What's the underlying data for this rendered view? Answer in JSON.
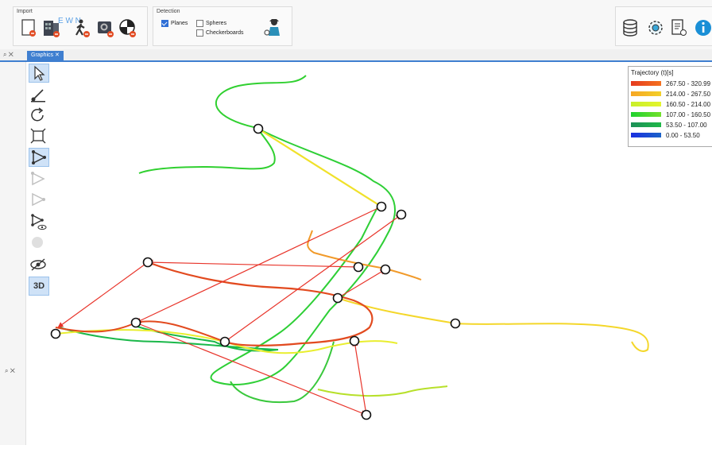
{
  "ribbon": {
    "import_group": {
      "title": "Import",
      "overlay_text": "E W N"
    },
    "detection_group": {
      "title": "Detection",
      "planes": {
        "label": "Planes",
        "checked": true
      },
      "spheres": {
        "label": "Spheres",
        "checked": false
      },
      "checkboards": {
        "label": "Checkerboards",
        "checked": false
      }
    }
  },
  "tabbar": {
    "graphics_tab": {
      "label": "Graphics"
    },
    "close_glyph": "✕",
    "pin_glyph": "⌕ ✕",
    "lower_pin_glyph": "⌕ ✕"
  },
  "left_toolbar": {
    "btn_3d_label": "3D"
  },
  "legend": {
    "title": "Trajectory (t)[s]",
    "entries": [
      {
        "label": "267.50 - 320.99",
        "color": "#e53b1f"
      },
      {
        "label": "214.00 - 267.50",
        "color": "#f6a623"
      },
      {
        "label": "160.50 - 214.00",
        "color": "#c8ef2a"
      },
      {
        "label": "107.00 - 160.50",
        "color": "#1fd12f"
      },
      {
        "label": "53.50 - 107.00",
        "color": "#1b8f57"
      },
      {
        "label": "0.00 - 53.50",
        "color": "#1a2fe0"
      }
    ]
  },
  "icons": {
    "import": [
      "new-file-icon",
      "building-import-icon",
      "walker-import-icon",
      "camera-import-icon",
      "target-import-icon"
    ],
    "detection": [
      "inspector-icon"
    ],
    "right": [
      "database-icon",
      "settings-gear-icon",
      "report-icon",
      "info-icon"
    ],
    "left": [
      "select-arrow-icon",
      "line-tool-icon",
      "rotate-icon",
      "box-tool-icon",
      "trajectory-tool-icon",
      "trajectory-disabled-icon",
      "trajectory-disabled-2-icon",
      "trajectory-visibility-icon",
      "sphere-disabled-icon",
      "eye-off-icon"
    ]
  }
}
